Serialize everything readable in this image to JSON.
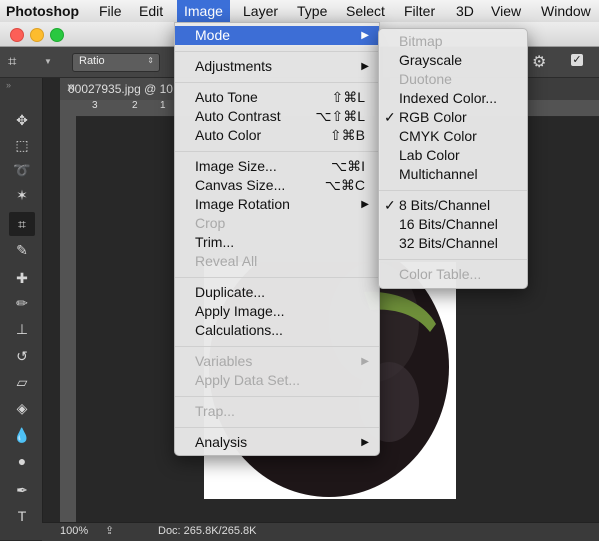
{
  "menubar": {
    "app": "Photoshop",
    "items": [
      "File",
      "Edit",
      "Image",
      "Layer",
      "Type",
      "Select",
      "Filter",
      "3D",
      "View",
      "Window"
    ]
  },
  "options_bar": {
    "style_value": "Ratio"
  },
  "document": {
    "tab_title": "00027935.jpg @ 10",
    "ruler_marks": [
      "3",
      "2",
      "1"
    ]
  },
  "status": {
    "zoom": "100%",
    "doc_size": "Doc: 265.8K/265.8K"
  },
  "image_menu": {
    "mode": "Mode",
    "adjustments": "Adjustments",
    "auto_tone": "Auto Tone",
    "auto_tone_sc": "⇧⌘L",
    "auto_contrast": "Auto Contrast",
    "auto_contrast_sc": "⌥⇧⌘L",
    "auto_color": "Auto Color",
    "auto_color_sc": "⇧⌘B",
    "image_size": "Image Size...",
    "image_size_sc": "⌥⌘I",
    "canvas_size": "Canvas Size...",
    "canvas_size_sc": "⌥⌘C",
    "image_rotation": "Image Rotation",
    "crop": "Crop",
    "trim": "Trim...",
    "reveal_all": "Reveal All",
    "duplicate": "Duplicate...",
    "apply_image": "Apply Image...",
    "calculations": "Calculations...",
    "variables": "Variables",
    "apply_data_set": "Apply Data Set...",
    "trap": "Trap...",
    "analysis": "Analysis"
  },
  "mode_menu": {
    "bitmap": "Bitmap",
    "grayscale": "Grayscale",
    "duotone": "Duotone",
    "indexed": "Indexed Color...",
    "rgb": "RGB Color",
    "cmyk": "CMYK Color",
    "lab": "Lab Color",
    "multichannel": "Multichannel",
    "bits8": "8 Bits/Channel",
    "bits16": "16 Bits/Channel",
    "bits32": "32 Bits/Channel",
    "color_table": "Color Table..."
  },
  "colors": {
    "accent": "#3b6fd8",
    "menu_bg": "#e8e8e8",
    "workspace": "#282828"
  }
}
